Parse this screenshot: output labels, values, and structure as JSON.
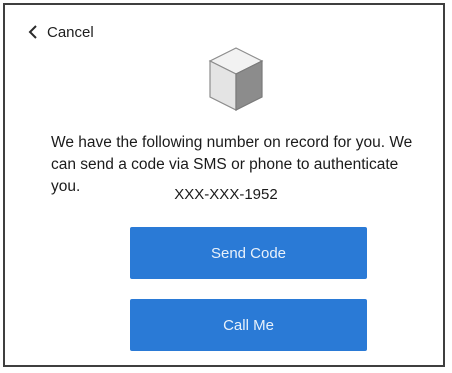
{
  "header": {
    "back_icon": "chevron-left-icon",
    "cancel_label": "Cancel"
  },
  "illustration": {
    "icon": "cube-icon"
  },
  "main": {
    "message": "We have the following number on record for you. We can send a code via SMS or phone to authenticate you.",
    "phone_number": "XXX-XXX-1952"
  },
  "actions": {
    "send_code_label": "Send Code",
    "call_me_label": "Call Me"
  },
  "colors": {
    "button_background": "#2a7ad6",
    "button_text": "#e8f1fb",
    "frame_border": "#3f3f3f"
  }
}
